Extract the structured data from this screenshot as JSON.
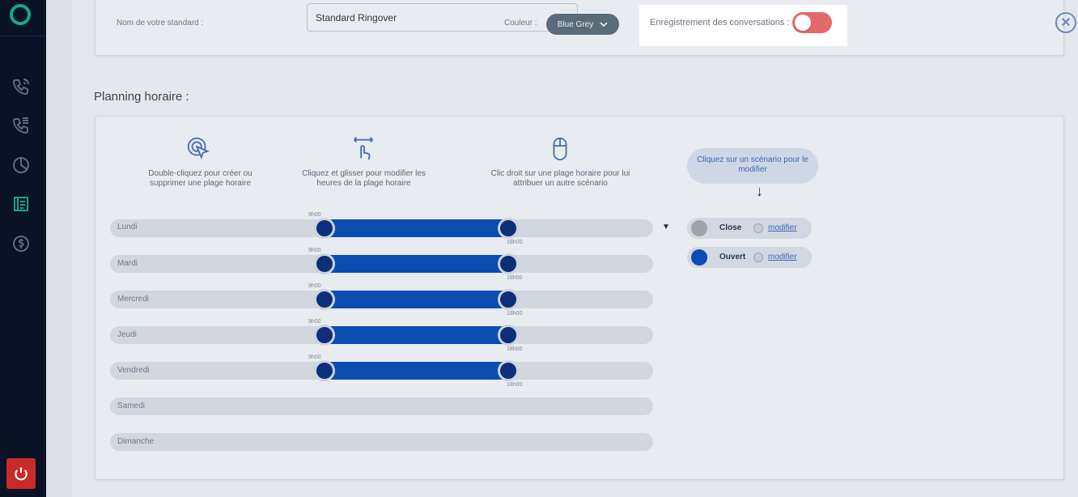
{
  "header": {
    "std_name_label": "Nom de votre standard :",
    "std_name_value": "Standard Ringover",
    "color_label": "Couleur :",
    "color_value": "Blue Grey",
    "recording_label": "Enregistrement des conversations :",
    "recording_enabled": false
  },
  "planning": {
    "title": "Planning horaire :",
    "help": [
      {
        "icon": "double-click-icon",
        "text": "Double-cliquez pour créer ou supprimer une plage horaire"
      },
      {
        "icon": "drag-icon",
        "text": "Cliquez et glisser pour modifier les heures de la plage horaire"
      },
      {
        "icon": "mouse-icon",
        "text": "Clic droit sur une plage horaire pour lui attribuer un autre scénario"
      }
    ],
    "days": [
      {
        "label": "Lundi",
        "start": "9h00",
        "end": "18h00"
      },
      {
        "label": "Mardi",
        "start": "9h00",
        "end": "18h00"
      },
      {
        "label": "Mercredi",
        "start": "9h00",
        "end": "18h00"
      },
      {
        "label": "Jeudi",
        "start": "9h00",
        "end": "18h00"
      },
      {
        "label": "Vendredi",
        "start": "9h00",
        "end": "18h00"
      },
      {
        "label": "Samedi"
      },
      {
        "label": "Dimanche"
      }
    ],
    "scenario_hint": "Cliquez sur un scénario pour le modifier",
    "scenarios": [
      {
        "name": "Close",
        "link": "modifier",
        "color": "#9ea3aa"
      },
      {
        "name": "Ouvert",
        "link": "modifier",
        "color": "#0a4cb0"
      }
    ]
  },
  "colors": {
    "sidebar": "#0a1226",
    "range": "#0a4cb0",
    "toggle_off": "#e56969",
    "power": "#c92a2a"
  }
}
